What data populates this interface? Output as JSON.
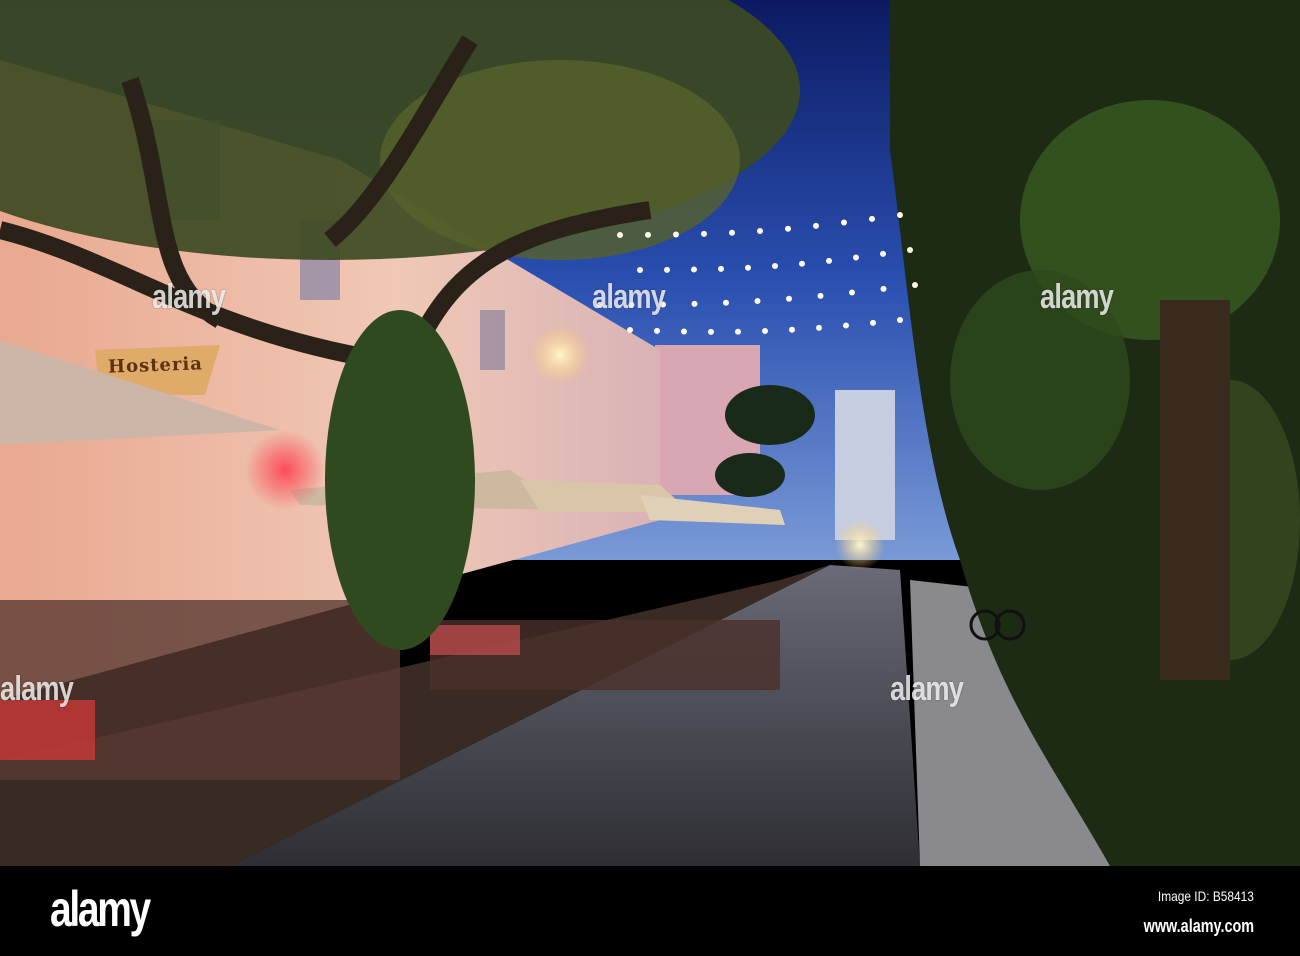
{
  "photo": {
    "subject": "Outdoor restaurant street at dusk",
    "sign_text": "Hosteria",
    "watermark": "alamy",
    "watermark_letter": "a"
  },
  "footer": {
    "logo": "alamy",
    "image_id": "Image ID: B58413",
    "url": "www.alamy.com"
  },
  "colors": {
    "sky_top": "#10206a",
    "sky_horizon": "#4f78c8",
    "building": "#e6b3a3",
    "street": "#4a4a52",
    "foliage": "#1e2a12"
  }
}
